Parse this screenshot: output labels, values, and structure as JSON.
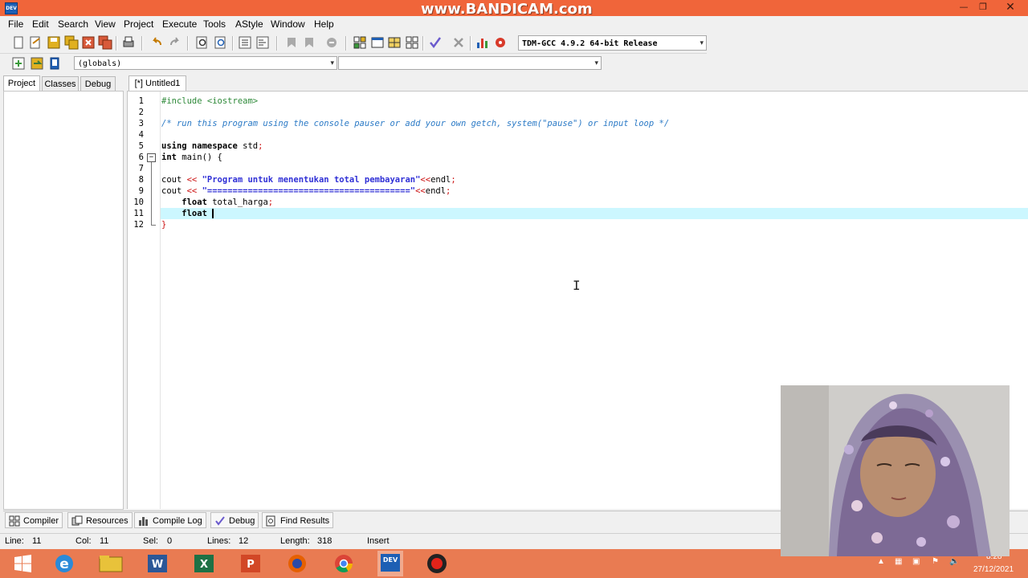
{
  "window": {
    "watermark": "www.BANDICAM.com",
    "minimize": "—",
    "maximize": "❐",
    "close": "✕"
  },
  "menu": [
    "File",
    "Edit",
    "Search",
    "View",
    "Project",
    "Execute",
    "Tools",
    "AStyle",
    "Window",
    "Help"
  ],
  "toolbar": {
    "compiler_select": "TDM-GCC 4.9.2 64-bit Release",
    "scope_select": "(globals)",
    "member_select": ""
  },
  "project_tabs": [
    "Project",
    "Classes",
    "Debug"
  ],
  "editor": {
    "tab_label": "[*] Untitled1",
    "line_numbers": [
      "1",
      "2",
      "3",
      "4",
      "5",
      "6",
      "7",
      "8",
      "9",
      "10",
      "11",
      "12"
    ],
    "current_line": 11,
    "lines": {
      "l1": "#include <iostream>",
      "l3": "/* run this program using the console pauser or add your own getch, system(\"pause\") or input loop */",
      "l5a": "using namespace",
      "l5b": " std",
      "l5c": ";",
      "l6a": "int",
      "l6b": " main",
      "l6c": "() {",
      "l8a": "cout ",
      "l8b": "<<",
      "l8c": " \"Program untuk menentukan total pembayaran\"",
      "l8d": "<<",
      "l8e": "endl",
      "l8f": ";",
      "l9a": "cout ",
      "l9b": "<<",
      "l9c": " \"========================================\"",
      "l9d": "<<",
      "l9e": "endl",
      "l9f": ";",
      "l10a": "    float",
      "l10b": " total_harga",
      "l10c": ";",
      "l11a": "    float",
      "l11b": " ",
      "l12": "}"
    }
  },
  "bottom_tabs": [
    "Compiler",
    "Resources",
    "Compile Log",
    "Debug",
    "Find Results"
  ],
  "status": {
    "line_label": "Line:",
    "line_value": "11",
    "col_label": "Col:",
    "col_value": "11",
    "sel_label": "Sel:",
    "sel_value": "0",
    "lines_label": "Lines:",
    "lines_value": "12",
    "length_label": "Length:",
    "length_value": "318",
    "mode": "Insert"
  },
  "taskbar": {
    "apps": [
      "start",
      "internet-explorer",
      "file-explorer",
      "word",
      "excel",
      "powerpoint",
      "firefox",
      "chrome",
      "dev-cpp",
      "bandicam"
    ],
    "clock_time": "8:28",
    "clock_date": "27/12/2021"
  },
  "colors": {
    "titlebar": "#f0653a",
    "taskbar": "#e97b52",
    "current_line": "#ccf7ff",
    "string": "#2f2fd6",
    "comment": "#2b7ac6",
    "preprocessor": "#2f8a3a",
    "operator": "#cc1111"
  }
}
